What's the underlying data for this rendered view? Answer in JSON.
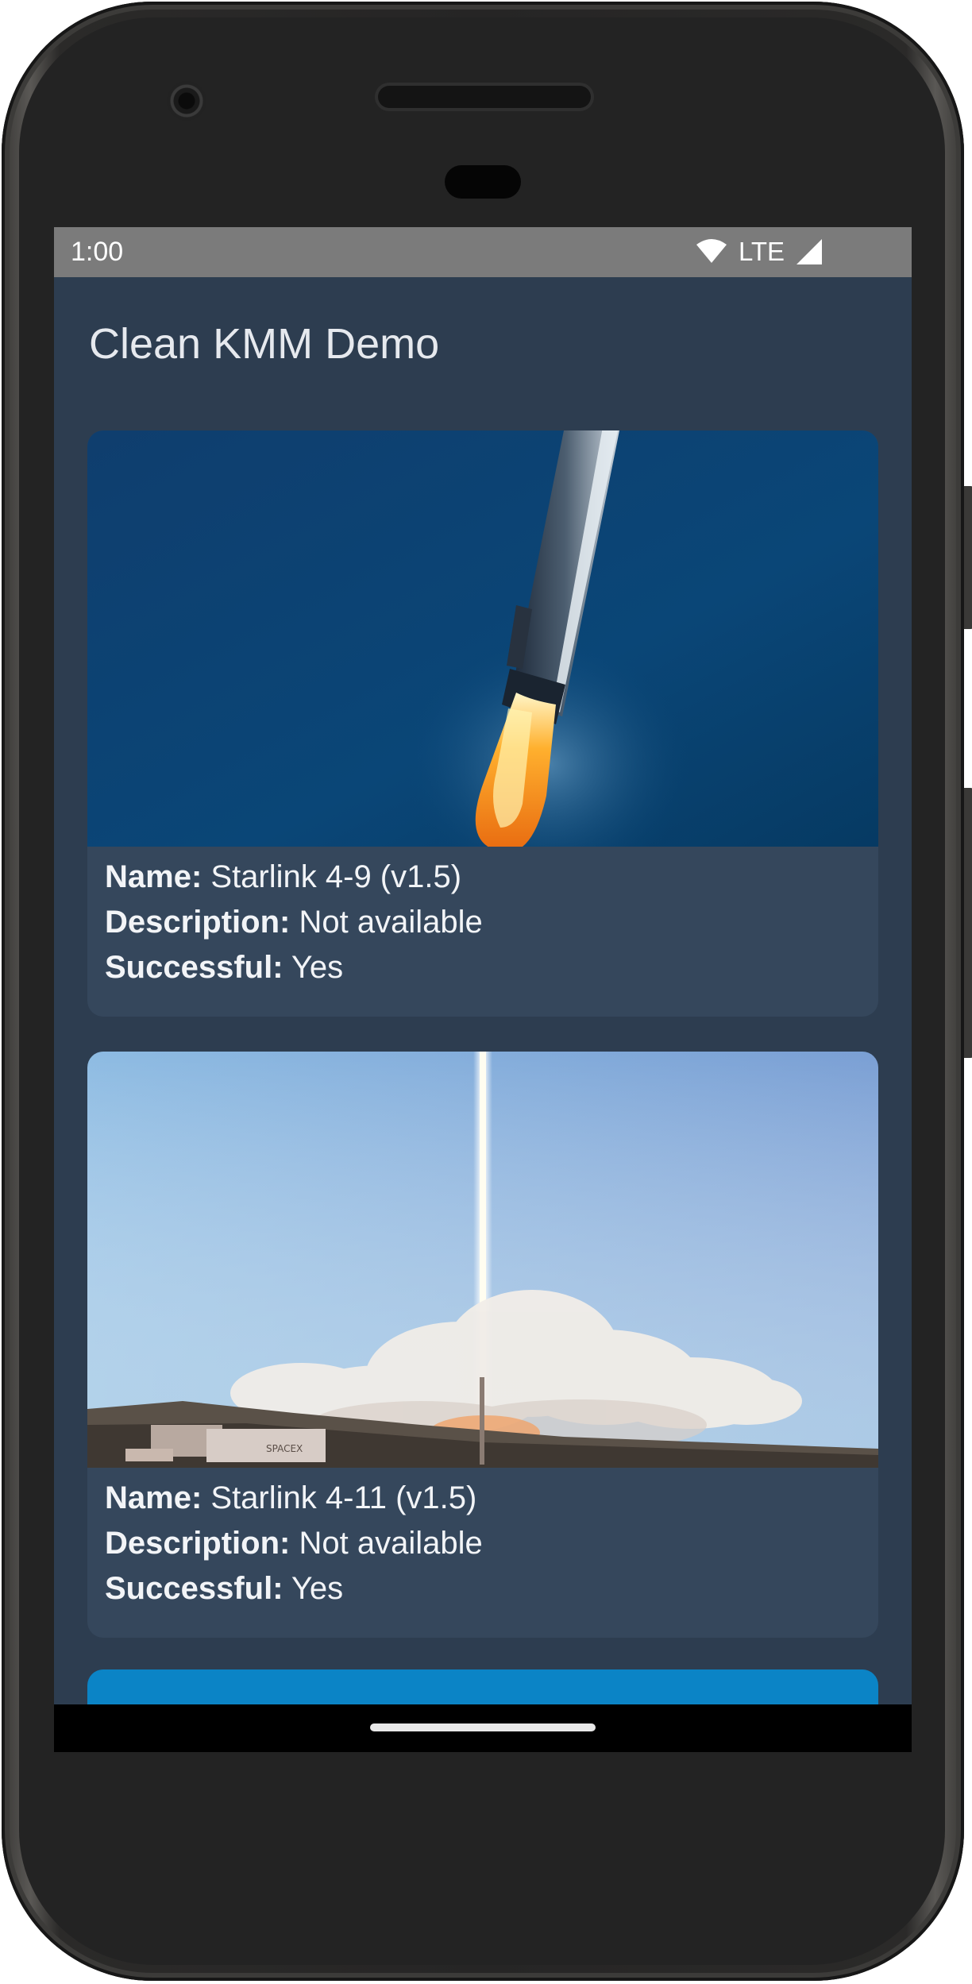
{
  "status_bar": {
    "time": "1:00",
    "network": "LTE",
    "icons": [
      "wifi-icon",
      "signal-icon"
    ]
  },
  "app": {
    "title": "Clean KMM Demo"
  },
  "labels": {
    "name": "Name:",
    "description": "Description:",
    "successful": "Successful:"
  },
  "launches": [
    {
      "name": "Starlink 4-9 (v1.5)",
      "description": "Not available",
      "successful": "Yes",
      "image": "rocket-ascending-in-sky-image"
    },
    {
      "name": "Starlink 4-11 (v1.5)",
      "description": "Not available",
      "successful": "Yes",
      "image": "rocket-liftoff-from-pad-image",
      "image_text": "SPACEX"
    }
  ],
  "colors": {
    "background": "#2d3d50",
    "card": "#35475c",
    "status_bar": "#7b7b7b",
    "partial_card": "#0b84c6"
  }
}
